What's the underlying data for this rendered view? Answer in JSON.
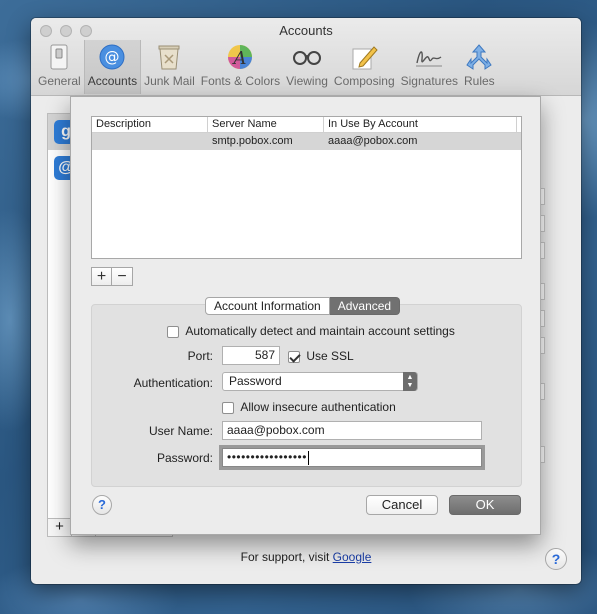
{
  "window": {
    "title": "Accounts"
  },
  "toolbar": {
    "items": [
      {
        "label": "General",
        "icon": "general-switch-icon"
      },
      {
        "label": "Accounts",
        "icon": "at-sign-icon"
      },
      {
        "label": "Junk Mail",
        "icon": "trash-icon"
      },
      {
        "label": "Fonts & Colors",
        "icon": "fonts-colors-icon"
      },
      {
        "label": "Viewing",
        "icon": "glasses-icon"
      },
      {
        "label": "Composing",
        "icon": "pencil-icon"
      },
      {
        "label": "Signatures",
        "icon": "signature-icon"
      },
      {
        "label": "Rules",
        "icon": "rules-icon"
      }
    ],
    "active": "Accounts"
  },
  "accounts_list": {
    "items": [
      {
        "badge": "g",
        "icon": "google-account-icon"
      },
      {
        "badge": "@",
        "icon": "mail-account-icon"
      }
    ],
    "add_label": "+"
  },
  "support": {
    "text": "For support, visit",
    "link": "Google"
  },
  "smtp_table": {
    "columns": [
      "Description",
      "Server Name",
      "In Use By Account"
    ],
    "rows": [
      {
        "description": "",
        "server": "smtp.pobox.com",
        "account": "aaaa@pobox.com"
      }
    ]
  },
  "list_controls": {
    "add": "+",
    "remove": "−"
  },
  "tabs": {
    "info": "Account Information",
    "advanced": "Advanced",
    "selected": "Advanced"
  },
  "advanced": {
    "auto_detect_label": "Automatically detect and maintain account settings",
    "auto_detect_checked": false,
    "port_label": "Port:",
    "port_value": "587",
    "use_ssl_label": "Use SSL",
    "use_ssl_checked": true,
    "auth_label": "Authentication:",
    "auth_value": "Password",
    "allow_insecure_label": "Allow insecure authentication",
    "allow_insecure_checked": false,
    "username_label": "User Name:",
    "username_value": "aaaa@pobox.com",
    "password_label": "Password:",
    "password_value": "•••••••••••••••••"
  },
  "buttons": {
    "help": "?",
    "cancel": "Cancel",
    "ok": "OK"
  }
}
